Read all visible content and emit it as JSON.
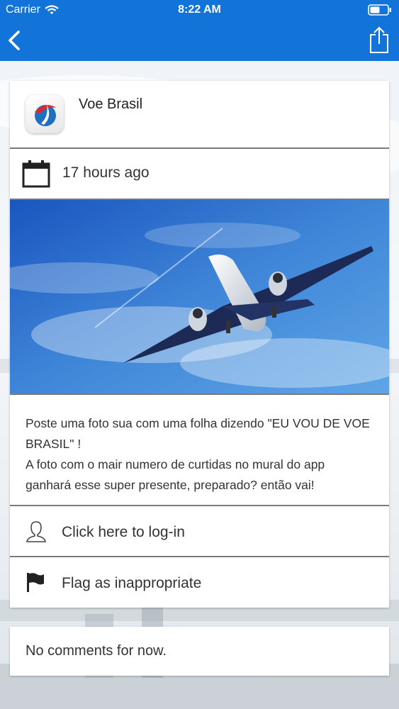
{
  "status_bar": {
    "carrier": "Carrier",
    "time": "8:22 AM"
  },
  "nav": {
    "back_icon": "chevron-left-icon",
    "share_icon": "share-icon"
  },
  "post": {
    "author": "Voe Brasil",
    "timestamp": "17 hours ago",
    "paragraphs": [
      "Poste uma foto sua com uma folha dizendo \"EU VOU DE VOE BRASIL\" !",
      "A foto com o mair numero de curtidas no mural do app ganhará esse super presente, preparado? então vai!"
    ],
    "login_label": "Click here to log-in",
    "flag_label": "Flag as inappropriate"
  },
  "comments": {
    "empty_text": "No comments for now."
  },
  "colors": {
    "nav_blue": "#1273d9",
    "sky_blue": "#1f63c9"
  }
}
